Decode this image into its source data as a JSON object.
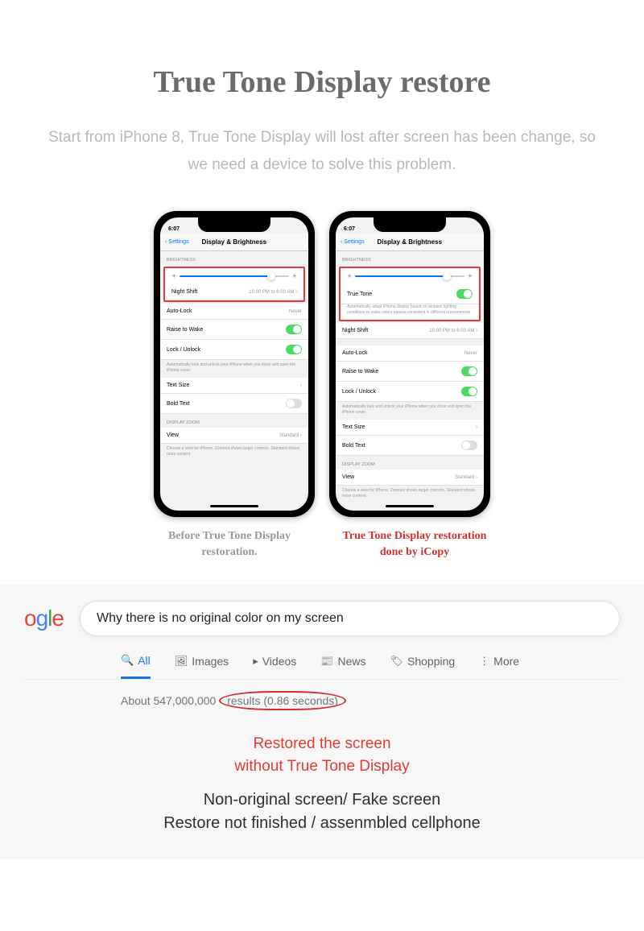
{
  "header": {
    "title": "True Tone Display restore",
    "subtitle": "Start from iPhone 8,  True Tone Display  will lost after screen has been change, so we need a device to solve this problem."
  },
  "phone_ui": {
    "time": "6:07",
    "back_label": "Settings",
    "page_title": "Display & Brightness",
    "brightness_header": "BRIGHTNESS",
    "true_tone_label": "True Tone",
    "true_tone_desc": "Automatically adapt iPhone display based on ambient lighting conditions to make colors appear consistent in different environments.",
    "night_shift_label": "Night Shift",
    "night_shift_value": "10:00 PM to 6:00 AM",
    "auto_lock_label": "Auto-Lock",
    "auto_lock_value": "Never",
    "raise_to_wake_label": "Raise to Wake",
    "lock_unlock_label": "Lock / Unlock",
    "lock_desc": "Automatically lock and unlock your iPhone when you close and open the iPhone cover.",
    "text_size_label": "Text Size",
    "bold_text_label": "Bold Text",
    "zoom_header": "DISPLAY ZOOM",
    "view_label": "View",
    "view_value": "Standard",
    "view_desc": "Choose a view for iPhone. Zoomed shows larger controls. Standard shows more content."
  },
  "captions": {
    "before": "Before True Tone Display restoration.",
    "after": "True Tone Display restoration done by iCopy"
  },
  "google": {
    "logo_partial": "ogle",
    "query": "Why there is no original color on my screen",
    "tabs": {
      "all": "All",
      "images": "Images",
      "videos": "Videos",
      "news": "News",
      "shopping": "Shopping",
      "more": "More"
    },
    "results_prefix": "About 547,000,000",
    "results_circled": "results (0.86 seconds)"
  },
  "callouts": {
    "red_line1": "Restored the screen",
    "red_line2": "without True Tone Display",
    "black_line1": "Non-original screen/ Fake screen",
    "black_line2": "Restore not finished / assenmbled cellphone"
  }
}
